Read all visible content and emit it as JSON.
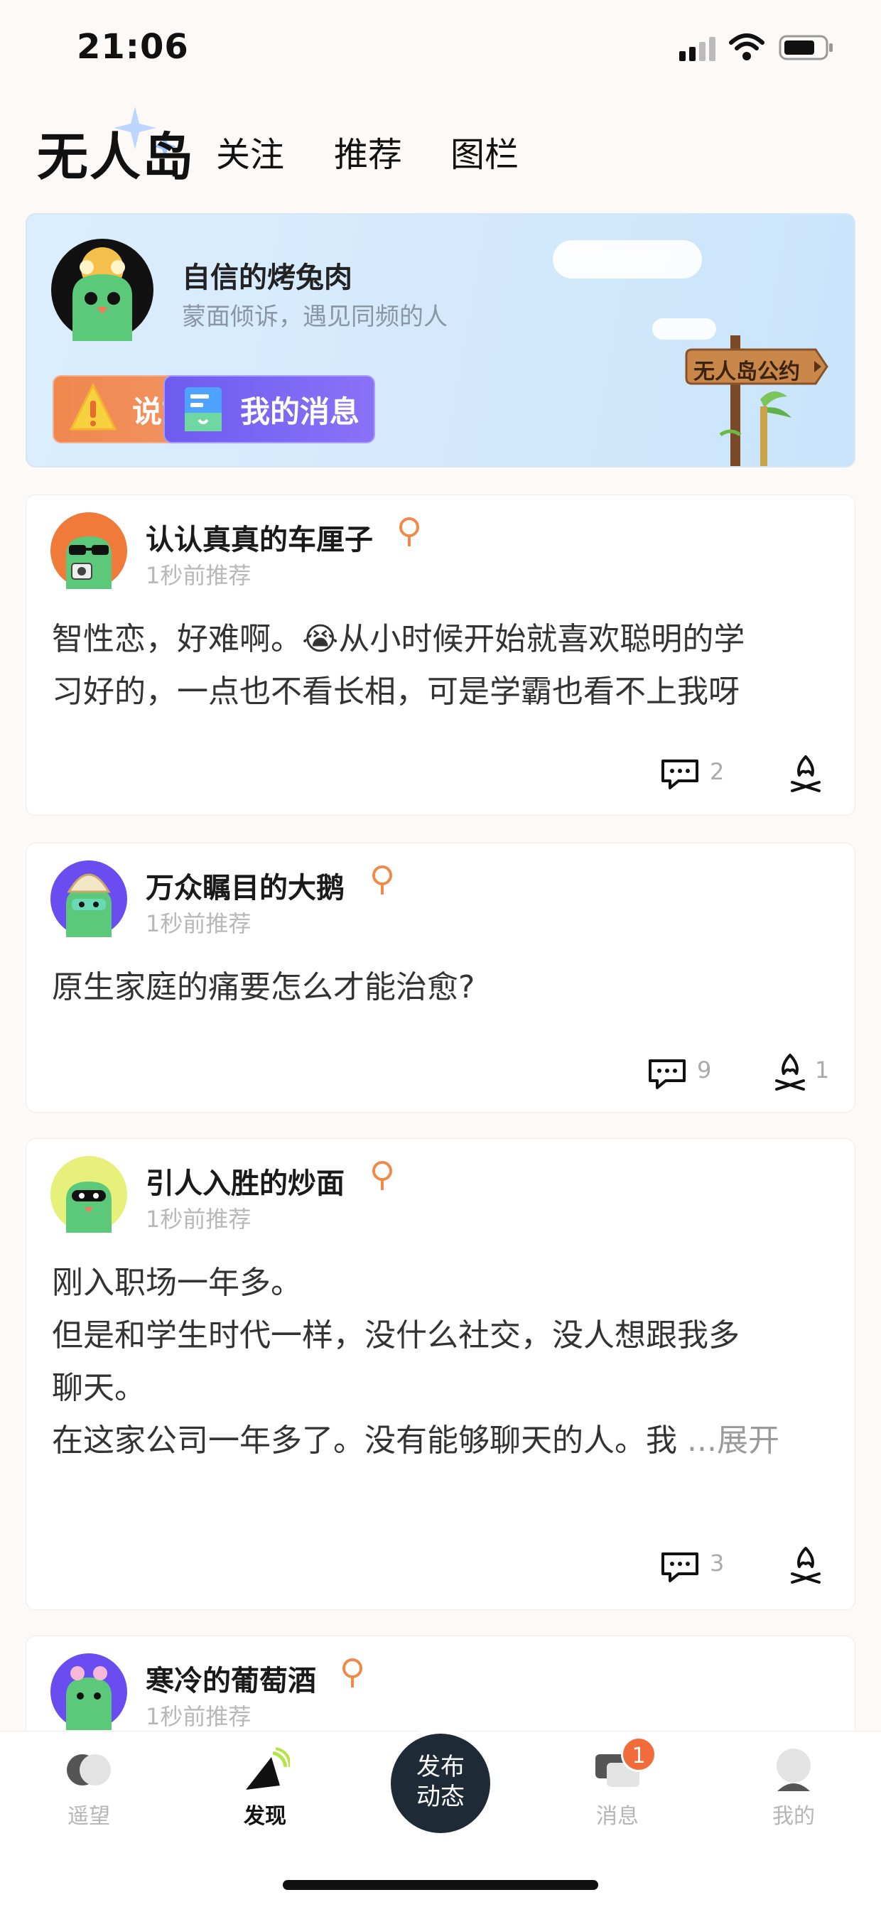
{
  "status_bar": {
    "time": "21:06"
  },
  "header": {
    "brand": "无人岛",
    "tabs": [
      {
        "label": "关注"
      },
      {
        "label": "推荐"
      },
      {
        "label": "图栏"
      }
    ]
  },
  "hero": {
    "name": "自信的烤兔肉",
    "subtitle": "蒙面倾诉，遇见同频的人",
    "story_button": "说故事",
    "messages_button": "我的消息",
    "sign_text": "无人岛公约"
  },
  "posts": [
    {
      "username": "认认真真的车厘子",
      "time": "1秒前推荐",
      "content_line1": "智性恋，好难啊。😭从小时候开始就喜欢聪明的学",
      "content_line2": "习好的，一点也不看长相，可是学霸也看不上我呀",
      "comments": "2",
      "likes": ""
    },
    {
      "username": "万众瞩目的大鹅",
      "time": "1秒前推荐",
      "content_line1": "原生家庭的痛要怎么才能治愈?",
      "comments": "9",
      "likes": "1"
    },
    {
      "username": "引人入胜的炒面",
      "time": "1秒前推荐",
      "content_line1": "刚入职场一年多。",
      "content_line2": "但是和学生时代一样，没什么社交，没人想跟我多",
      "content_line3": "聊天。",
      "content_line4": "在这家公司一年多了。没有能够聊天的人。我 ",
      "expand": "...展开",
      "comments": "3",
      "likes": ""
    },
    {
      "username": "寒冷的葡萄酒",
      "time": "1秒前推荐"
    }
  ],
  "bottom_nav": {
    "items": [
      {
        "label": "遥望"
      },
      {
        "label": "发现"
      },
      {
        "label": "消息"
      },
      {
        "label": "我的"
      }
    ],
    "publish_line1": "发布",
    "publish_line2": "动态",
    "message_badge": "1"
  },
  "colors": {
    "accent_orange": "#f0874f",
    "accent_purple": "#6e5cf0",
    "avatar_green": "#5cc97a",
    "dark_button": "#1f2a37"
  }
}
